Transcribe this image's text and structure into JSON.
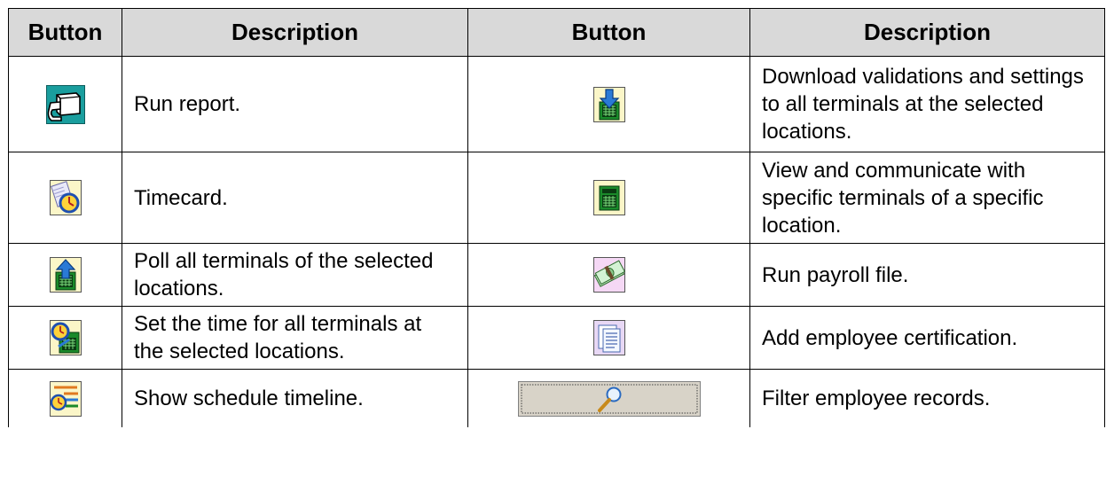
{
  "table": {
    "headers": [
      "Button",
      "Description",
      "Button",
      "Description"
    ],
    "rows": [
      {
        "left": {
          "icon": "printer-report-icon",
          "description": "Run report."
        },
        "right": {
          "icon": "download-terminal-icon",
          "description": "Download validations and settings to all terminals at the selected locations."
        }
      },
      {
        "left": {
          "icon": "timecard-clock-icon",
          "description": "Timecard."
        },
        "right": {
          "icon": "terminal-calculator-icon",
          "description": "View and communicate with specific terminals of a specific location."
        }
      },
      {
        "left": {
          "icon": "poll-upload-terminal-icon",
          "description": "Poll all terminals of the selected locations."
        },
        "right": {
          "icon": "payroll-money-icon",
          "description": "Run payroll file."
        }
      },
      {
        "left": {
          "icon": "set-time-clock-terminal-icon",
          "description": "Set the time for all terminals at the selected locations."
        },
        "right": {
          "icon": "certification-document-icon",
          "description": "Add employee certification."
        }
      },
      {
        "left": {
          "icon": "schedule-timeline-icon",
          "description": "Show schedule timeline."
        },
        "right": {
          "icon": "magnifier-filter-icon",
          "description": "Filter employee records."
        }
      }
    ]
  },
  "colors": {
    "header_bg": "#d9d9d9",
    "icon_teal": "#1a9e9e",
    "icon_cream": "#fbf6c8",
    "icon_green": "#1a8a2a",
    "icon_blue": "#2a7ad6",
    "filter_button_bg": "#d8d3c8"
  }
}
